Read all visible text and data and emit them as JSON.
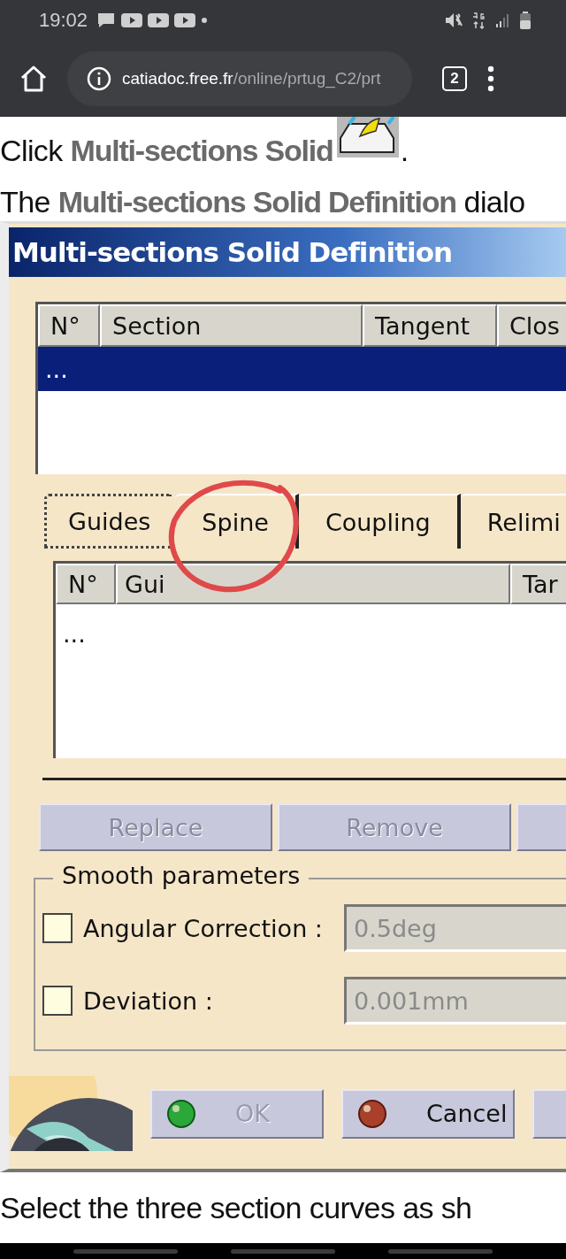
{
  "status_bar": {
    "time": "19:02"
  },
  "browser": {
    "url_host": "catiadoc.free.fr",
    "url_path": "/online/prtug_C2/prt",
    "tab_count": "2"
  },
  "intro_line_1": {
    "text": "Click  **Multi-sections Solid**",
    "end": "."
  },
  "intro_line_2": "The **Multi-sections Solid Definition** dialo",
  "dialog": {
    "title": "Multi-sections Solid Definition",
    "sections_table": {
      "columns": [
        "N°",
        "Section",
        "Tangent",
        "Clos"
      ],
      "rows": [
        {
          "cells": [
            "..."
          ],
          "selected": true
        }
      ]
    },
    "tabs": [
      {
        "label": "Guides",
        "selected": true
      },
      {
        "label": "Spine",
        "selected": false
      },
      {
        "label": "Coupling",
        "selected": false
      },
      {
        "label": "Relimi",
        "selected": false
      }
    ],
    "guides_table": {
      "columns": [
        "N°",
        "Gui",
        "Tar"
      ],
      "rows": [
        {
          "cells": [
            "..."
          ],
          "selected": false
        }
      ]
    },
    "list_buttons": [
      {
        "label": "Replace",
        "disabled": true
      },
      {
        "label": "Remove",
        "disabled": true
      }
    ],
    "smooth_parameters": {
      "legend": "Smooth parameters",
      "rows": [
        {
          "label": "Angular Correction :",
          "checked": false,
          "value": "0.5deg",
          "disabled": true
        },
        {
          "label": "Deviation :",
          "checked": false,
          "value": "0.001mm",
          "disabled": true
        }
      ]
    },
    "footer_buttons": [
      {
        "label": "OK",
        "kind": "ok",
        "disabled": true
      },
      {
        "label": "Cancel",
        "kind": "cancel",
        "disabled": false
      }
    ]
  },
  "outro": "Select the three section curves as sh"
}
